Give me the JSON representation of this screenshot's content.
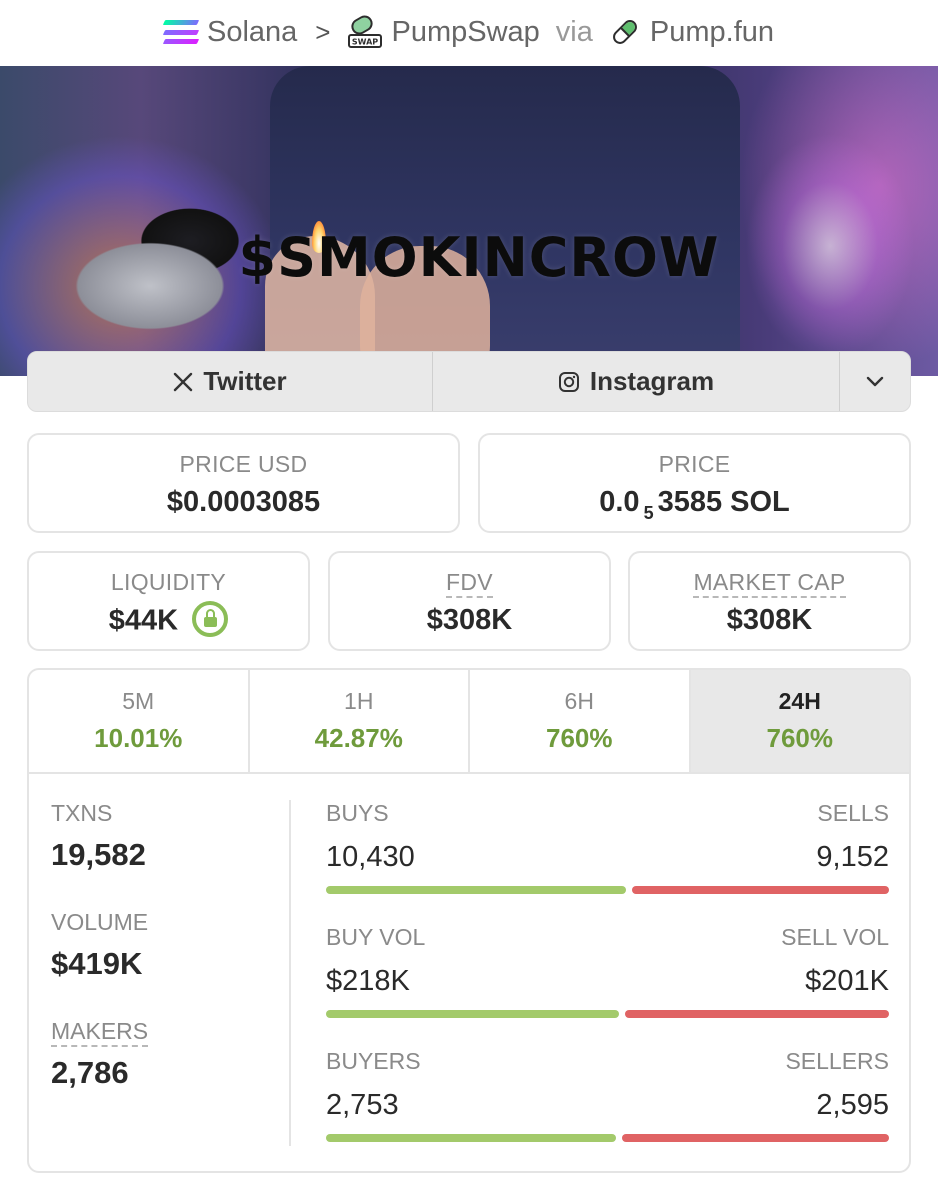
{
  "breadcrumb": {
    "chain": "Solana",
    "separator": ">",
    "dex": "PumpSwap",
    "via": "via",
    "launchpad": "Pump.fun",
    "swap_badge": "SWAP"
  },
  "banner": {
    "title": "$SMOKINCROW"
  },
  "social": {
    "twitter": "Twitter",
    "instagram": "Instagram"
  },
  "price_usd": {
    "label": "PRICE USD",
    "value": "$0.0003085"
  },
  "price": {
    "label": "PRICE",
    "prefix": "0.0",
    "zeros": "5",
    "suffix": "3585 SOL"
  },
  "liquidity": {
    "label": "LIQUIDITY",
    "value": "$44K"
  },
  "fdv": {
    "label": "FDV",
    "value": "$308K"
  },
  "market_cap": {
    "label": "MARKET CAP",
    "value": "$308K"
  },
  "tabs": [
    {
      "label": "5M",
      "value": "10.01%"
    },
    {
      "label": "1H",
      "value": "42.87%"
    },
    {
      "label": "6H",
      "value": "760%"
    },
    {
      "label": "24H",
      "value": "760%",
      "active": true
    }
  ],
  "metrics": {
    "txns": {
      "label": "TXNS",
      "value": "19,582"
    },
    "volume": {
      "label": "VOLUME",
      "value": "$419K"
    },
    "makers": {
      "label": "MAKERS",
      "value": "2,786"
    }
  },
  "splits": [
    {
      "left_label": "BUYS",
      "right_label": "SELLS",
      "left_value": "10,430",
      "right_value": "9,152",
      "left_share": 0.533
    },
    {
      "left_label": "BUY VOL",
      "right_label": "SELL VOL",
      "left_value": "$218K",
      "right_value": "$201K",
      "left_share": 0.52
    },
    {
      "left_label": "BUYERS",
      "right_label": "SELLERS",
      "left_value": "2,753",
      "right_value": "2,595",
      "left_share": 0.515
    }
  ],
  "colors": {
    "positive": "#6f9b3c",
    "buy_bar": "#a3ca6b",
    "sell_bar": "#e06364"
  }
}
